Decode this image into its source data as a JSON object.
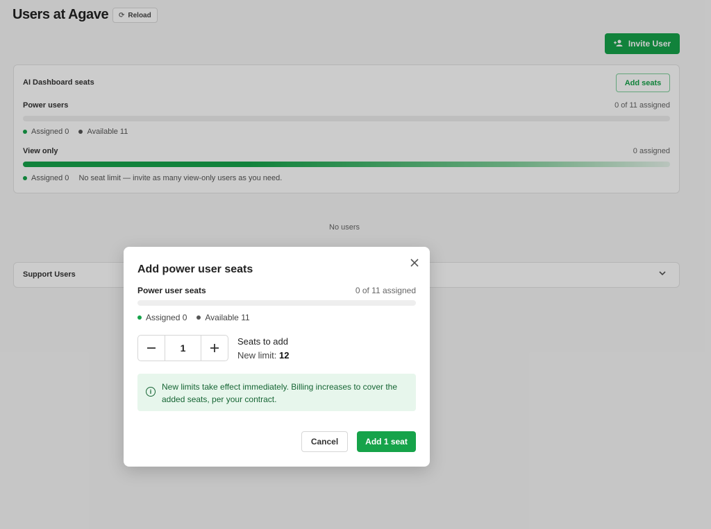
{
  "page": {
    "title": "Users at Agave",
    "reload_label": "Reload",
    "invite_label": "Invite User"
  },
  "seats_card": {
    "title": "AI Dashboard seats",
    "add_seats_label": "Add seats",
    "power": {
      "label": "Power users",
      "assigned_text": "0 of 11 assigned",
      "fill_fraction": 0,
      "legend_assigned": "Assigned 0",
      "legend_available": "Available 11"
    },
    "view_only": {
      "label": "View only",
      "assigned_text": "0 assigned",
      "legend_assigned": "Assigned 0",
      "note": "No seat limit — invite as many view-only users as you need."
    }
  },
  "no_users_text": "No users",
  "support": {
    "label": "Support Users"
  },
  "modal": {
    "title": "Add power user seats",
    "seats_label": "Power user seats",
    "assigned_text": "0 of 11 assigned",
    "legend_assigned": "Assigned 0",
    "legend_available": "Available 11",
    "stepper_value": "1",
    "seats_to_add_label": "Seats to add",
    "new_limit_label": "New limit:",
    "new_limit_value": "12",
    "info_text": "New limits take effect immediately. Billing increases to cover the added seats, per your contract.",
    "cancel_label": "Cancel",
    "confirm_label": "Add 1 seat"
  },
  "colors": {
    "accent": "#16a34a",
    "info_bg": "#e7f6ec",
    "info_text": "#166534"
  }
}
